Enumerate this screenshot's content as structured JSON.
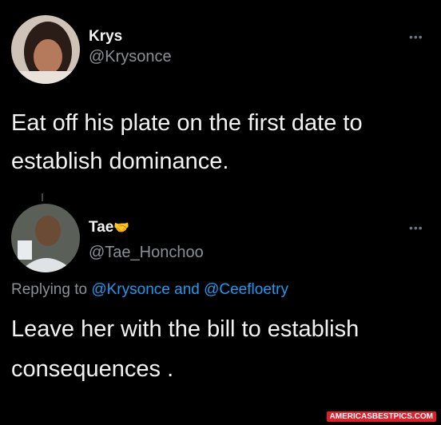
{
  "tweet1": {
    "name": "Krys",
    "handle": "@Krysonce",
    "text": "Eat off his plate on the first date to establish dominance.",
    "more_icon": "ellipsis-icon"
  },
  "tweet2": {
    "name": "Tae",
    "name_emoji": "🤝",
    "handle": "@Tae_Honchoo",
    "replying_prefix": "Replying to",
    "mention1": "@Krysonce",
    "and_text": "and",
    "mention2": "@Ceefloetry",
    "text_line1": "Leave her with the bill to establish",
    "text_line2": "consequences .",
    "more_icon": "ellipsis-icon"
  },
  "watermark": "AMERICASBESTPICS.COM",
  "colors": {
    "background": "#000000",
    "mention": "#1d9bf0",
    "muted": "#8b9097"
  }
}
